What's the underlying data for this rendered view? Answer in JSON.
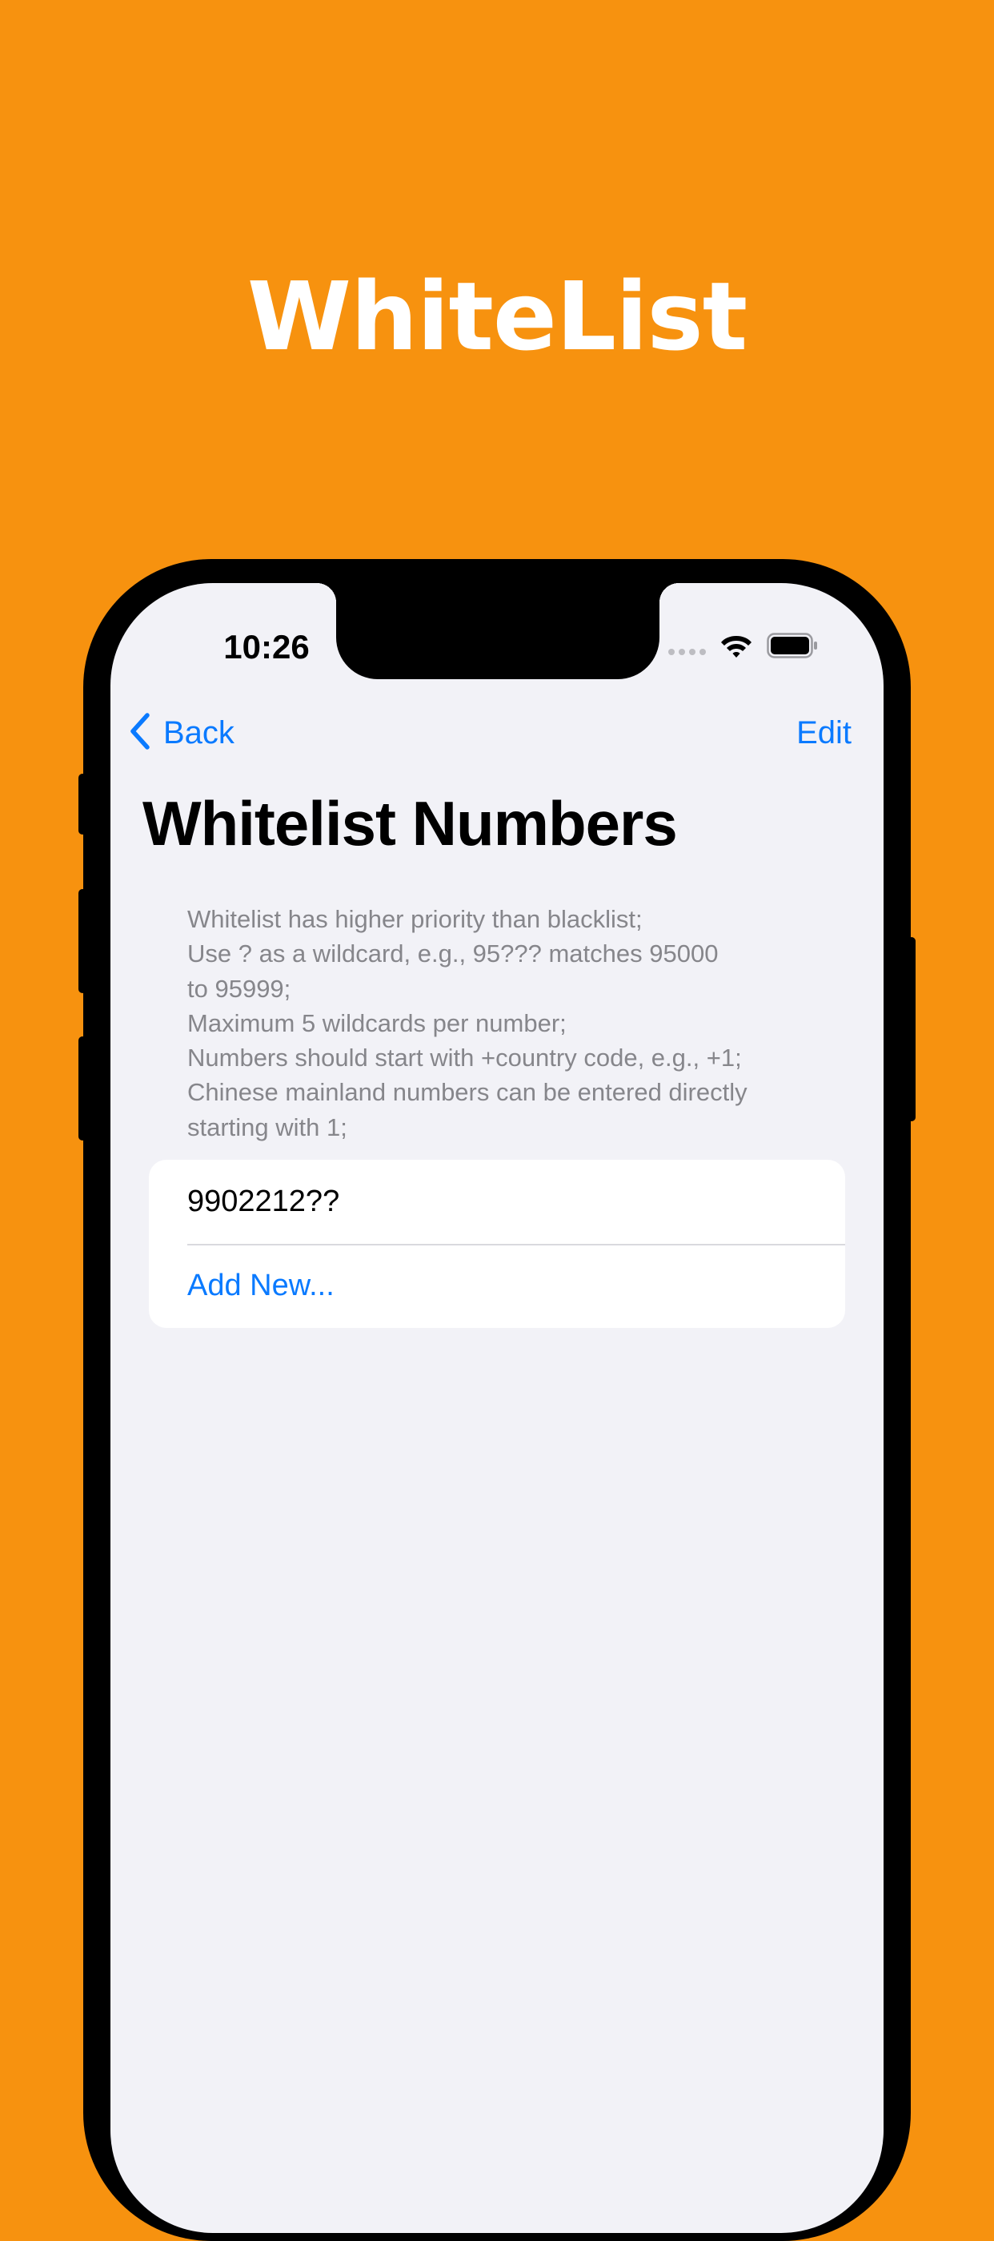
{
  "hero": {
    "title": "WhiteList"
  },
  "status_bar": {
    "time": "10:26",
    "icons": [
      "cellular-signal-icon",
      "wifi-icon",
      "battery-icon"
    ]
  },
  "nav": {
    "back_label": "Back",
    "edit_label": "Edit",
    "back_icon": "chevron-left-icon"
  },
  "page": {
    "title": "Whitelist Numbers"
  },
  "instructions": {
    "lines": [
      "Whitelist has higher priority than blacklist;",
      "Use ? as a wildcard, e.g., 95??? matches 95000",
      "to 95999;",
      "Maximum 5 wildcards per number;",
      "Numbers should start with +country code, e.g., +1;",
      "Chinese mainland numbers can be entered directly",
      "starting with 1;"
    ]
  },
  "whitelist": {
    "numbers": [
      "9902212??"
    ],
    "add_label": "Add New..."
  },
  "colors": {
    "background": "#F7920F",
    "accent": "#0A7AFF",
    "screen_background": "#F2F2F7",
    "secondary_text": "#86868B"
  }
}
